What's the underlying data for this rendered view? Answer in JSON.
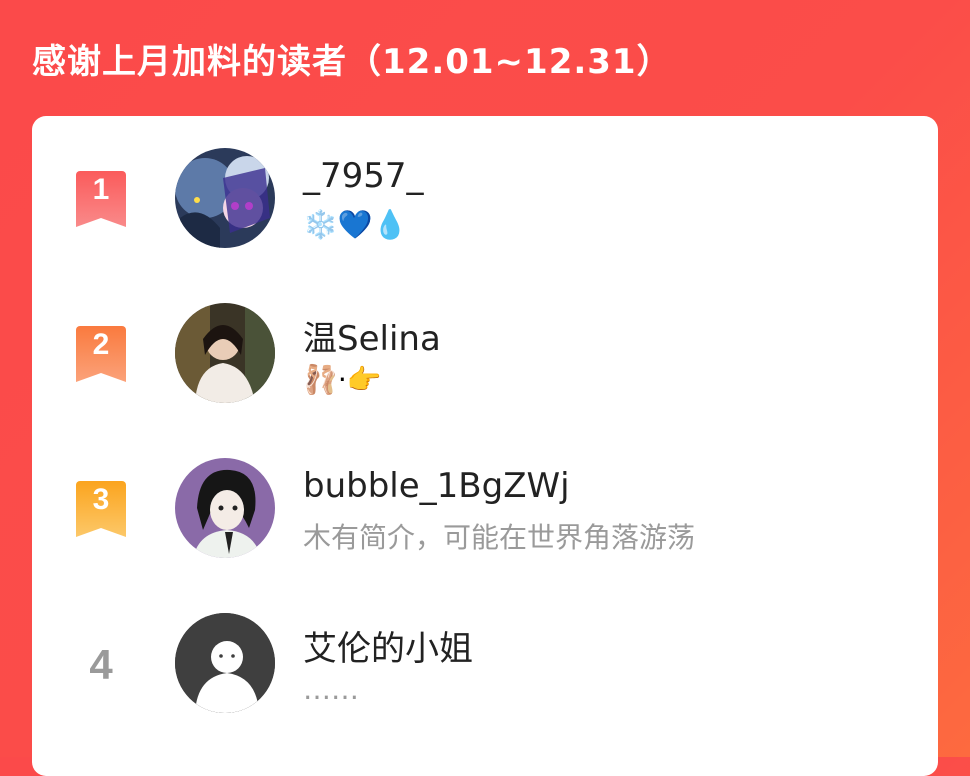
{
  "header": {
    "title": "感谢上月加料的读者（12.01~12.31）"
  },
  "readers": [
    {
      "rank": "1",
      "name": "_7957_",
      "bio": "❄️💙💧",
      "avatar_icon": "anime-avatar-icon",
      "badge_color": "#f96a6a"
    },
    {
      "rank": "2",
      "name": "温Selina",
      "bio": "🩰·👉",
      "avatar_icon": "photo-avatar-icon",
      "badge_color": "#fa8148"
    },
    {
      "rank": "3",
      "name": "bubble_1BgZWj",
      "bio": "木有简介，可能在世界角落游荡",
      "avatar_icon": "illustration-avatar-icon",
      "badge_color": "#fbb12c"
    },
    {
      "rank": "4",
      "name": "艾伦的小姐",
      "bio": "……",
      "avatar_icon": "default-avatar-icon",
      "badge_color": ""
    }
  ]
}
